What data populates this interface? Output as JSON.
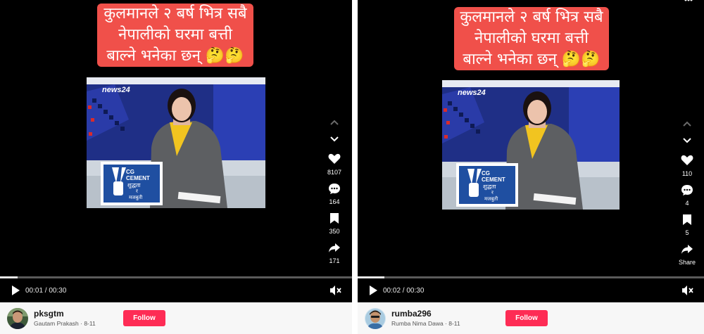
{
  "left_post": {
    "caption_lines": [
      "कुलमानले २ बर्ष भित्र सबै",
      "नेपालीको घरमा बत्ती",
      "बाल्ने भनेका छन् 🤔🤔"
    ],
    "thumbnail": {
      "channel_logo": "news24",
      "podium_logo": "CG CEMENT",
      "podium_text_1": "शुद्धता",
      "podium_text_2": "र",
      "podium_text_3": "मजबुती"
    },
    "likes": "8107",
    "comments": "164",
    "saves": "350",
    "shares": "171",
    "progress": 0.05,
    "timecode": "00:01 / 00:30",
    "username": "pksgtm",
    "display_name_date": "Gautam Prakash · 8-11",
    "follow_label": "Follow"
  },
  "right_post": {
    "caption_lines": [
      "कुलमानले २ बर्ष भित्र सबै",
      "नेपालीको घरमा बत्ती",
      "बाल्ने भनेका छन् 🤔🤔"
    ],
    "thumbnail": {
      "channel_logo": "news24",
      "podium_logo": "CG CEMENT",
      "podium_text_1": "शुद्धता",
      "podium_text_2": "र",
      "podium_text_3": "मजबुती"
    },
    "likes": "110",
    "comments": "4",
    "saves": "5",
    "shares": "Share",
    "progress": 0.08,
    "timecode": "00:02 / 00:30",
    "username": "rumba296",
    "display_name_date": "Rumba Nima Dawa · 8-11",
    "follow_label": "Follow"
  },
  "icons": [
    "chevron-up-icon",
    "chevron-down-icon",
    "heart-icon",
    "comment-icon",
    "bookmark-icon",
    "share-icon",
    "play-icon",
    "mute-icon",
    "more-icon"
  ],
  "colors": {
    "caption_bg": "#f0504a",
    "follow_bg": "#fe2c55",
    "player_bg": "#000000",
    "footer_bg": "#f7f7f7"
  }
}
